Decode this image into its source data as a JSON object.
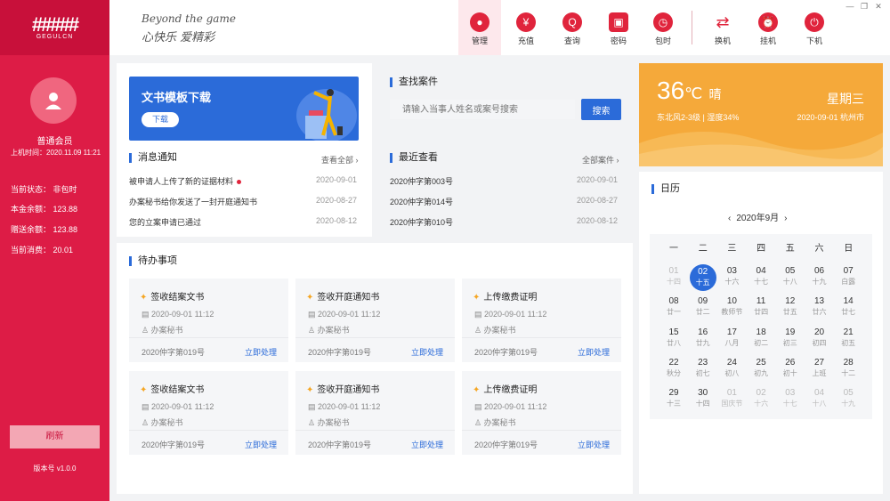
{
  "sidebar": {
    "logo_text": "#####",
    "logo_sub": "GEGULCN",
    "user_role": "普通会员",
    "login_time": "上机时间：2020.11.09  11:21",
    "status": "当前状态：  非包时",
    "principal": "本金余额：  123.88",
    "bonus": "赠送余额：  123.88",
    "consumption": "当前消费：  20.01",
    "refresh": "刷新",
    "version": "版本号   v1.0.0"
  },
  "header": {
    "slogan_en": "Beyond the game",
    "slogan_cn": "心快乐 爱精彩",
    "nav": [
      {
        "label": "管理",
        "icon": "user-icon"
      },
      {
        "label": "充值",
        "icon": "money-bag-icon"
      },
      {
        "label": "查询",
        "icon": "search-icon"
      },
      {
        "label": "密码",
        "icon": "lock-icon"
      },
      {
        "label": "包时",
        "icon": "clock-icon"
      },
      {
        "label": "换机",
        "icon": "swap-icon"
      },
      {
        "label": "挂机",
        "icon": "alarm-icon"
      },
      {
        "label": "下机",
        "icon": "power-icon"
      }
    ],
    "window_controls": [
      "minimize",
      "restore",
      "close"
    ]
  },
  "banner": {
    "title": "文书模板下载",
    "button": "下载"
  },
  "notices": {
    "title": "消息通知",
    "more": "查看全部",
    "items": [
      {
        "text": "被申请人上传了新的证据材料",
        "date": "2020-09-01",
        "unread": true
      },
      {
        "text": "办案秘书给你发送了一封开庭通知书",
        "date": "2020-08-27",
        "unread": false
      },
      {
        "text": "您的立案申请已通过",
        "date": "2020-08-12",
        "unread": false
      }
    ]
  },
  "case_search": {
    "title": "查找案件",
    "placeholder": "请输入当事人姓名或案号搜索",
    "button": "搜索"
  },
  "recent": {
    "title": "最近查看",
    "more": "全部案件",
    "items": [
      {
        "text": "2020仲字第003号",
        "date": "2020-09-01"
      },
      {
        "text": "2020仲字第014号",
        "date": "2020-08-27"
      },
      {
        "text": "2020仲字第010号",
        "date": "2020-08-12"
      }
    ]
  },
  "todo": {
    "title": "待办事项",
    "items": [
      {
        "title": "签收结案文书",
        "time": "2020-09-01 11:12",
        "role": "办案秘书",
        "case": "2020仲字第019号",
        "action": "立即处理"
      },
      {
        "title": "签收开庭通知书",
        "time": "2020-09-01 11:12",
        "role": "办案秘书",
        "case": "2020仲字第019号",
        "action": "立即处理"
      },
      {
        "title": "上传缴费证明",
        "time": "2020-09-01 11:12",
        "role": "办案秘书",
        "case": "2020仲字第019号",
        "action": "立即处理"
      },
      {
        "title": "签收结案文书",
        "time": "2020-09-01 11:12",
        "role": "办案秘书",
        "case": "2020仲字第019号",
        "action": "立即处理"
      },
      {
        "title": "签收开庭通知书",
        "time": "2020-09-01 11:12",
        "role": "办案秘书",
        "case": "2020仲字第019号",
        "action": "立即处理"
      },
      {
        "title": "上传缴费证明",
        "time": "2020-09-01 11:12",
        "role": "办案秘书",
        "case": "2020仲字第019号",
        "action": "立即处理"
      }
    ]
  },
  "weather": {
    "temp": "36",
    "unit": "℃",
    "condition": "晴",
    "detail": "东北风2-3级 | 湿度34%",
    "weekday": "星期三",
    "date_city": "2020-09-01  杭州市"
  },
  "calendar": {
    "title": "日历",
    "month": "2020年9月",
    "weekdays": [
      "一",
      "二",
      "三",
      "四",
      "五",
      "六",
      "日"
    ],
    "weeks": [
      [
        {
          "d": "01",
          "l": "十四",
          "dim": true
        },
        {
          "d": "02",
          "l": "十五",
          "today": true
        },
        {
          "d": "03",
          "l": "十六"
        },
        {
          "d": "04",
          "l": "十七"
        },
        {
          "d": "05",
          "l": "十八"
        },
        {
          "d": "06",
          "l": "十九"
        },
        {
          "d": "07",
          "l": "白露"
        }
      ],
      [
        {
          "d": "08",
          "l": "廿一"
        },
        {
          "d": "09",
          "l": "廿二"
        },
        {
          "d": "10",
          "l": "教师节"
        },
        {
          "d": "11",
          "l": "廿四"
        },
        {
          "d": "12",
          "l": "廿五"
        },
        {
          "d": "13",
          "l": "廿六"
        },
        {
          "d": "14",
          "l": "廿七"
        }
      ],
      [
        {
          "d": "15",
          "l": "廿八"
        },
        {
          "d": "16",
          "l": "廿九"
        },
        {
          "d": "17",
          "l": "八月"
        },
        {
          "d": "18",
          "l": "初二"
        },
        {
          "d": "19",
          "l": "初三"
        },
        {
          "d": "20",
          "l": "初四"
        },
        {
          "d": "21",
          "l": "初五"
        }
      ],
      [
        {
          "d": "22",
          "l": "秋分"
        },
        {
          "d": "23",
          "l": "初七"
        },
        {
          "d": "24",
          "l": "初八"
        },
        {
          "d": "25",
          "l": "初九"
        },
        {
          "d": "26",
          "l": "初十"
        },
        {
          "d": "27",
          "l": "上班"
        },
        {
          "d": "28",
          "l": "十二"
        }
      ],
      [
        {
          "d": "29",
          "l": "十三"
        },
        {
          "d": "30",
          "l": "十四"
        },
        {
          "d": "01",
          "l": "国庆节",
          "dim": true
        },
        {
          "d": "02",
          "l": "十六",
          "dim": true
        },
        {
          "d": "03",
          "l": "十七",
          "dim": true
        },
        {
          "d": "04",
          "l": "十八",
          "dim": true
        },
        {
          "d": "05",
          "l": "十九",
          "dim": true
        }
      ]
    ]
  },
  "colors": {
    "sidebar": "#dd1c46",
    "accent": "#2b6bd9",
    "weather": "#f5a93a",
    "nav_icon": "#e0243c"
  }
}
